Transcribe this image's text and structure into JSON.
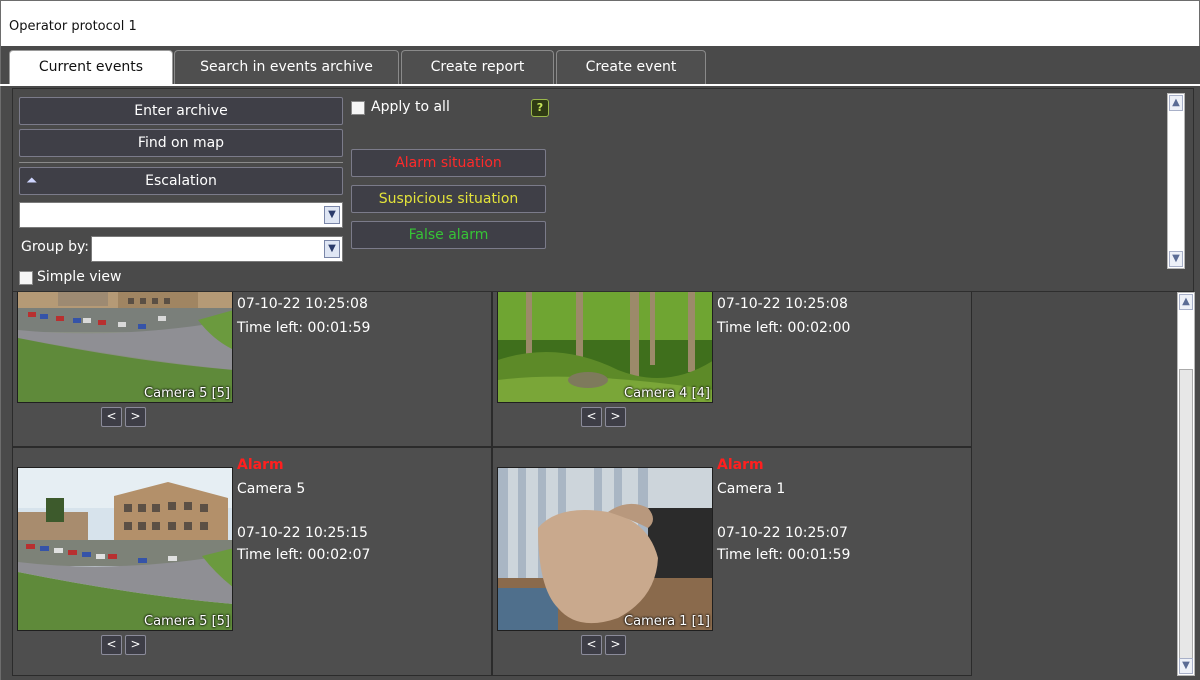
{
  "window": {
    "title": "Operator protocol 1"
  },
  "tabs": [
    {
      "label": "Current events",
      "active": true
    },
    {
      "label": "Search in events archive",
      "active": false
    },
    {
      "label": "Create report",
      "active": false
    },
    {
      "label": "Create event",
      "active": false
    }
  ],
  "panel": {
    "enter_archive": "Enter archive",
    "find_on_map": "Find on map",
    "escalation": "Escalation",
    "filter_value": "",
    "group_by_label": "Group by:",
    "group_by_value": "",
    "simple_view": "Simple view",
    "apply_to_all": "Apply to all",
    "help": "?",
    "alarm_situation": "Alarm situation",
    "suspicious_situation": "Suspicious situation",
    "false_alarm": "False alarm"
  },
  "colors": {
    "alarm_red": "#ff1f1f",
    "suspicious_yellow": "#e3e33a",
    "false_green": "#36c436"
  },
  "events": [
    {
      "camera_overlay": "Camera 5 [5]",
      "datetime": "07-10-22 10:25:08",
      "time_left": "Time left: 00:01:59"
    },
    {
      "camera_overlay": "Camera 4 [4]",
      "datetime": "07-10-22 10:25:08",
      "time_left": "Time left: 00:02:00"
    },
    {
      "status": "Alarm",
      "camera": "Camera 5",
      "camera_overlay": "Camera 5 [5]",
      "datetime": "07-10-22 10:25:15",
      "time_left": "Time left: 00:02:07"
    },
    {
      "status": "Alarm",
      "camera": "Camera 1",
      "camera_overlay": "Camera 1 [1]",
      "datetime": "07-10-22 10:25:07",
      "time_left": "Time left: 00:01:59"
    }
  ],
  "nav": {
    "prev": "<",
    "next": ">"
  },
  "icons": {
    "escalation": "double-chevron-up-icon",
    "combo_arrow": "chevron-down-icon",
    "scroll_up": "chevron-up-icon",
    "scroll_down": "chevron-down-icon"
  }
}
